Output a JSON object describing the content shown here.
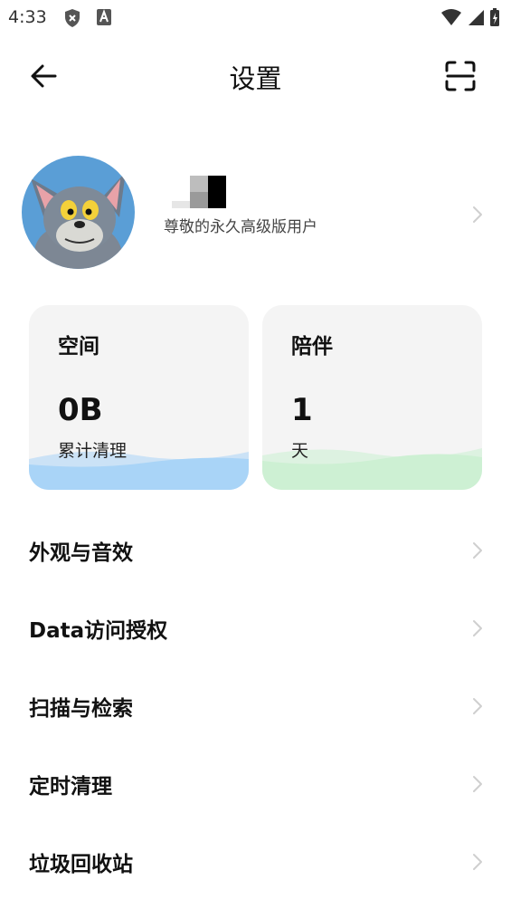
{
  "status_bar": {
    "time": "4:33",
    "icons": [
      "shield-icon",
      "a-box-icon",
      "wifi-icon",
      "signal-icon",
      "battery-charging-icon"
    ]
  },
  "header": {
    "title": "设置",
    "back_icon": "arrow-left-icon",
    "scan_icon": "scan-icon"
  },
  "profile": {
    "level_text": "尊敬的永久高级版用户"
  },
  "cards": {
    "space": {
      "title": "空间",
      "value": "0B",
      "caption": "累计清理",
      "accent": "#a9d4f7"
    },
    "days": {
      "title": "陪伴",
      "value": "1",
      "caption": "天",
      "accent": "#cdf0d3"
    }
  },
  "menu": [
    {
      "label": "外观与音效"
    },
    {
      "label": "Data访问授权"
    },
    {
      "label": "扫描与检索"
    },
    {
      "label": "定时清理"
    },
    {
      "label": "垃圾回收站"
    }
  ]
}
